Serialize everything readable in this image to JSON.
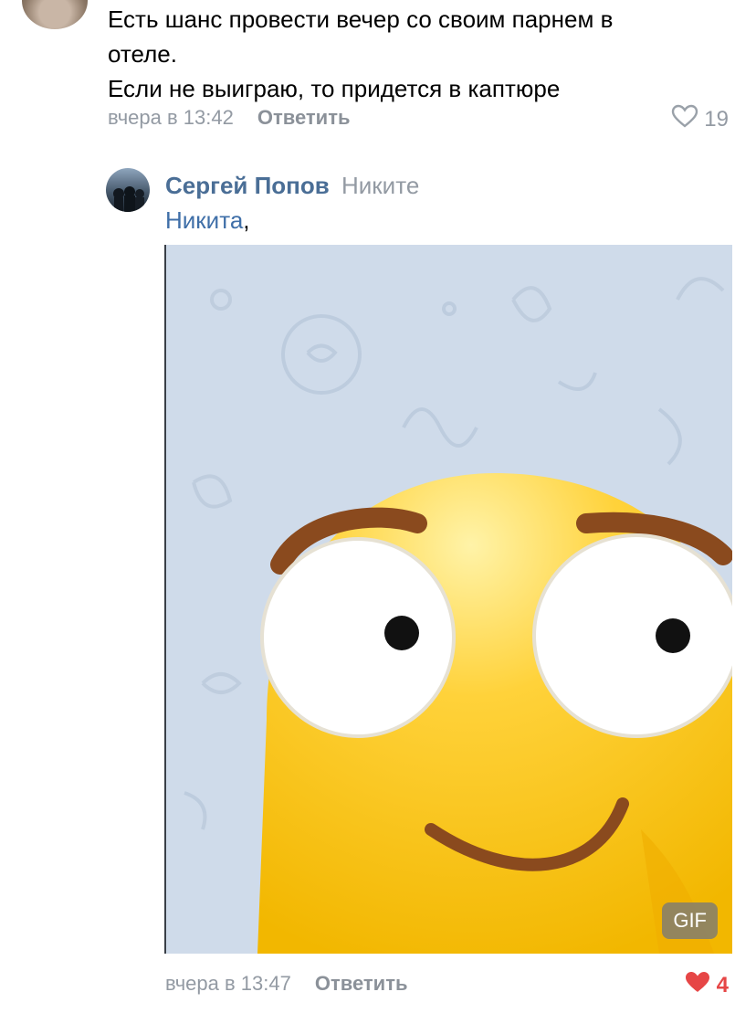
{
  "comment": {
    "lines": [
      "Есть шанс провести вечер со своим парнем в",
      "отеле.",
      "Если не выиграю, то придется в каптюре"
    ],
    "time": "вчера в 13:42",
    "reply_label": "Ответить",
    "likes": "19"
  },
  "reply": {
    "author": "Сергей Попов",
    "to": "Никите",
    "mention": "Никита",
    "mention_suffix": ",",
    "gif_label": "GIF",
    "time": "вчера в 13:47",
    "reply_label": "Ответить",
    "likes": "4",
    "liked": true,
    "like_color": "#e64646"
  },
  "icons": {
    "like_outline": "heart-outline-icon",
    "like_filled": "heart-filled-icon"
  }
}
